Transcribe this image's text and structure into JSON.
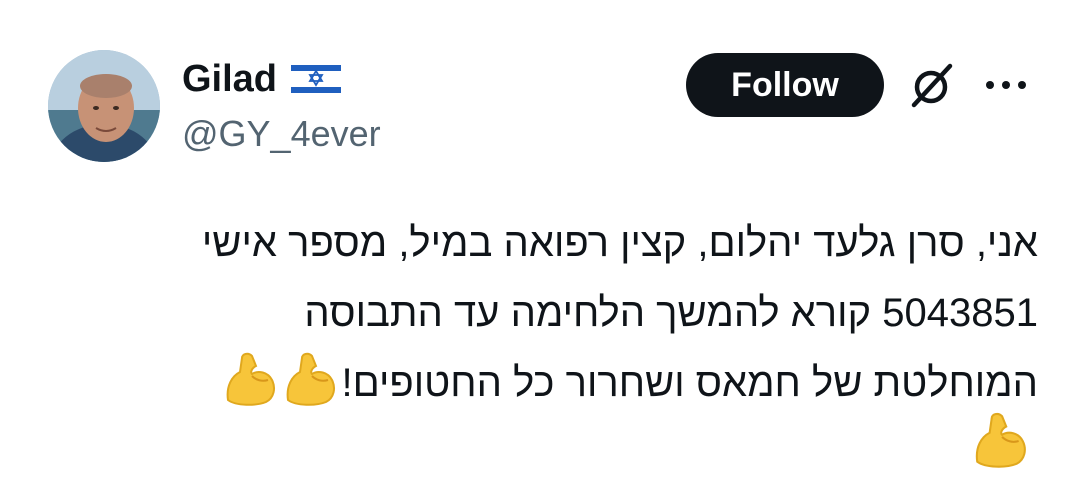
{
  "author": {
    "display_name": "Gilad",
    "flag": "israel-flag-icon",
    "handle": "@GY_4ever"
  },
  "actions": {
    "follow_label": "Follow",
    "grok_icon": "grok-icon",
    "more_icon": "more-dots-icon"
  },
  "tweet": {
    "lines": [
      "אני, סרן גלעד יהלום, קצין רפואה במיל, מספר אישי",
      "5043851 קורא להמשך הלחימה עד התבוסה",
      "המוחלטת של חמאס ושחרור כל החטופים!"
    ],
    "emoji": "💪"
  },
  "colors": {
    "text": "#0f1419",
    "secondary": "#536471",
    "follow_bg": "#0f1419",
    "follow_text": "#ffffff"
  }
}
